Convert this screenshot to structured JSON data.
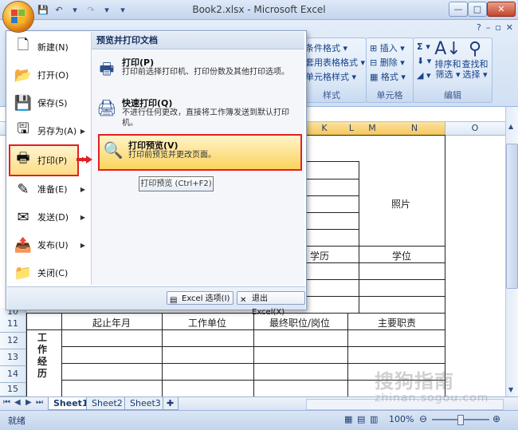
{
  "window": {
    "title": "Book2.xlsx - Microsoft Excel",
    "buttons": {
      "minimize": "—",
      "maximize": "□",
      "close": "✕"
    }
  },
  "ribbon": {
    "help_icons": [
      "?",
      "–",
      "▫",
      "✕"
    ],
    "styles_group": {
      "label": "样式",
      "items": [
        "条件格式 ▾",
        "套用表格格式 ▾",
        "单元格样式 ▾"
      ]
    },
    "cells_group": {
      "label": "单元格",
      "items": [
        "插入 ▾",
        "删除 ▾",
        "格式 ▾"
      ]
    },
    "editing_group": {
      "label": "编辑",
      "sum_icon": "Σ ▾",
      "sort_label_1": "排序和",
      "sort_label_2": "筛选 ▾",
      "find_label_1": "查找和",
      "find_label_2": "选择 ▾"
    }
  },
  "sheet": {
    "columns": [
      "K",
      "L",
      "M",
      "N",
      "O"
    ],
    "rows": [
      "11",
      "12",
      "13",
      "14",
      "15"
    ],
    "row_10_partial": "10",
    "cells": {
      "photo": "照片",
      "education": "学历",
      "degree": "学位",
      "period": "起止年月",
      "employer": "工作单位",
      "last_position": "最终职位/岗位",
      "main_duties": "主要职责",
      "work_experience": "工作经历"
    },
    "tabs": [
      "Sheet1",
      "Sheet2",
      "Sheet3"
    ]
  },
  "status": {
    "ready": "就绪",
    "zoom": "100%"
  },
  "office_menu": {
    "left_items": [
      {
        "label": "新建(N)",
        "icon": "new-document-icon",
        "has_arrow": false
      },
      {
        "label": "打开(O)",
        "icon": "open-folder-icon",
        "has_arrow": false
      },
      {
        "label": "保存(S)",
        "icon": "save-disk-icon",
        "has_arrow": false
      },
      {
        "label": "另存为(A)",
        "icon": "save-as-icon",
        "has_arrow": true
      },
      {
        "label": "打印(P)",
        "icon": "printer-icon",
        "has_arrow": true
      },
      {
        "label": "准备(E)",
        "icon": "prepare-icon",
        "has_arrow": true
      },
      {
        "label": "发送(D)",
        "icon": "send-icon",
        "has_arrow": true
      },
      {
        "label": "发布(U)",
        "icon": "publish-icon",
        "has_arrow": true
      },
      {
        "label": "关闭(C)",
        "icon": "close-folder-icon",
        "has_arrow": false
      }
    ],
    "right_title": "预览并打印文档",
    "sub_items": [
      {
        "title": "打印(P)",
        "desc": "打印前选择打印机、打印份数及其他打印选项。"
      },
      {
        "title": "快速打印(Q)",
        "desc": "不进行任何更改，直接将工作簿发送到默认打印机。"
      },
      {
        "title": "打印预览(V)",
        "desc": "打印前预览并更改页面。"
      }
    ],
    "excel_options": "Excel 选项(I)",
    "exit_excel": "退出 Excel(X)"
  },
  "tooltip": "打印预览 (Ctrl+F2)",
  "watermark": {
    "cn": "搜狗指南",
    "en": "zhinan.sogou.com"
  },
  "colors": {
    "highlight_border": "#e32020",
    "menu_hover": "#fedd84"
  }
}
